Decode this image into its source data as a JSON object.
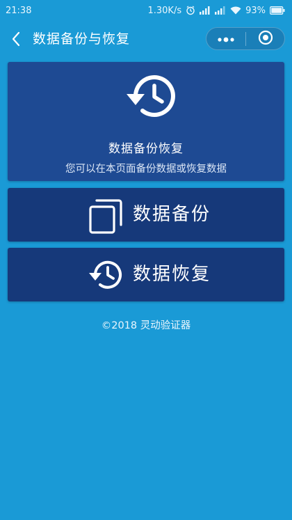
{
  "status_bar": {
    "time": "21:38",
    "network_speed": "1.30K/s",
    "battery": "93%",
    "icons": [
      "alarm-icon",
      "signal-icon",
      "signal-icon",
      "wifi-icon",
      "battery-icon"
    ]
  },
  "nav": {
    "title": "数据备份与恢复",
    "back_icon": "chevron-left-icon",
    "more_icon": "more-dots-icon",
    "close_icon": "target-circle-icon"
  },
  "header_card": {
    "icon": "history-icon",
    "title": "数据备份恢复",
    "subtitle": "您可以在本页面备份数据或恢复数据"
  },
  "actions": {
    "backup": {
      "icon": "copy-icon",
      "label": "数据备份"
    },
    "restore": {
      "icon": "history-icon",
      "label": "数据恢复"
    }
  },
  "footer": {
    "text": "©2018 灵动验证器"
  },
  "colors": {
    "background": "#1a9ad6",
    "header_card": "#1e4a93",
    "action_card": "#16397a",
    "text": "#ffffff"
  }
}
